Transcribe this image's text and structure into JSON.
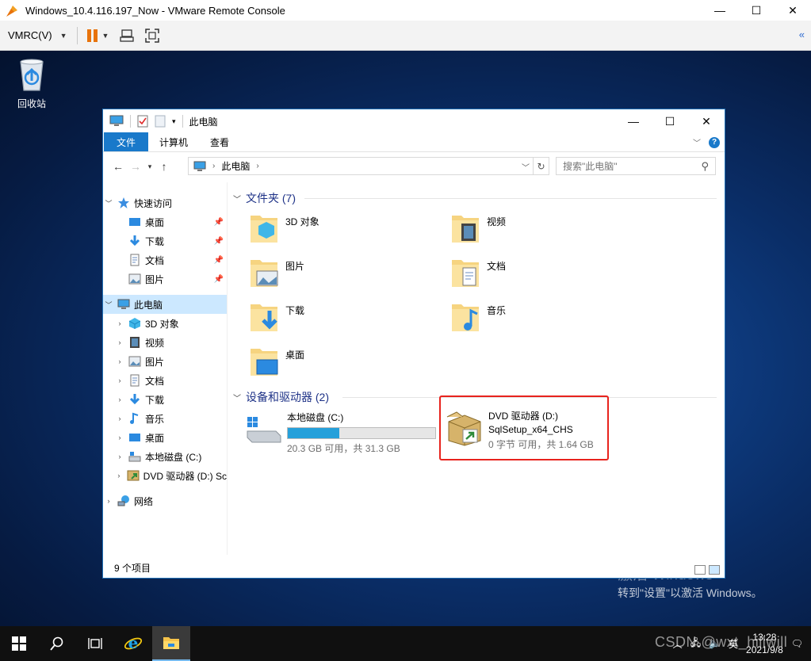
{
  "vm": {
    "title": "Windows_10.4.116.197_Now - VMware Remote Console",
    "menu_label": "VMRC(V)",
    "caption": {
      "minimize": "—",
      "maximize": "☐",
      "close": "✕"
    },
    "collapse": "«"
  },
  "desktop": {
    "recycle_bin_label": "回收站",
    "watermark_title": "激活 Windows",
    "watermark_sub": "转到\"设置\"以激活 Windows。"
  },
  "explorer": {
    "title": "此电脑",
    "tabs": [
      "文件",
      "计算机",
      "查看"
    ],
    "address_path": "此电脑",
    "search_placeholder": "搜索\"此电脑\"",
    "nav": {
      "quick_access": "快速访问",
      "quick_items": [
        "桌面",
        "下载",
        "文档",
        "图片"
      ],
      "this_pc": "此电脑",
      "pc_items": [
        "3D 对象",
        "视频",
        "图片",
        "文档",
        "下载",
        "音乐",
        "桌面",
        "本地磁盘 (C:)",
        "DVD 驱动器 (D:) Sc"
      ],
      "network": "网络"
    },
    "folders_header": "文件夹 (7)",
    "folders": [
      "3D 对象",
      "视频",
      "图片",
      "文档",
      "下载",
      "音乐",
      "桌面"
    ],
    "devices_header": "设备和驱动器 (2)",
    "drive_c": {
      "name": "本地磁盘 (C:)",
      "free": "20.3 GB 可用，共 31.3 GB",
      "used_fraction": 0.35
    },
    "drive_d": {
      "name": "DVD 驱动器 (D:)",
      "label": "SqlSetup_x64_CHS",
      "free": "0 字节 可用，共 1.64 GB"
    },
    "status": "9 个项目"
  },
  "taskbar": {
    "time": "13:28",
    "date": "2021/9/8",
    "lang": "英",
    "overlay": "CSDN @wxt_hillwill"
  },
  "colors": {
    "accent": "#1979ca",
    "highlight": "#e8231d",
    "drive_bar": "#26a0da"
  }
}
